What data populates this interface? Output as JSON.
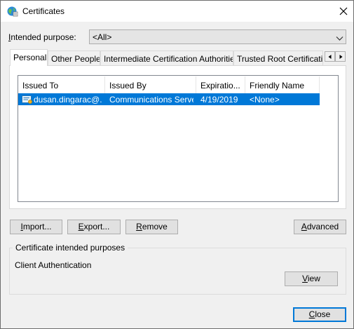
{
  "window": {
    "title": "Certificates",
    "icon": "certificate-globe-icon"
  },
  "purpose": {
    "label": "Intended purpose:",
    "label_accel": "I",
    "label_rest": "ntended purpose:",
    "value": "<All>"
  },
  "tabs": [
    {
      "label": "Personal",
      "active": true
    },
    {
      "label": "Other People",
      "active": false
    },
    {
      "label": "Intermediate Certification Authorities",
      "active": false
    },
    {
      "label": "Trusted Root Certification",
      "active": false
    }
  ],
  "table": {
    "columns": [
      "Issued To",
      "Issued By",
      "Expiratio...",
      "Friendly Name"
    ],
    "rows": [
      {
        "issued_to": "dusan.dingarac@...",
        "issued_by": "Communications Server",
        "expiration": "4/19/2019",
        "friendly_name": "<None>",
        "selected": true
      }
    ]
  },
  "buttons": {
    "import": {
      "accel": "I",
      "rest": "mport..."
    },
    "export": {
      "accel": "E",
      "rest": "xport..."
    },
    "remove": {
      "accel": "R",
      "rest": "emove"
    },
    "advanced": {
      "accel": "A",
      "rest": "dvanced"
    },
    "view": {
      "accel": "V",
      "rest": "iew"
    },
    "close": {
      "accel": "C",
      "rest": "lose"
    }
  },
  "purposes_group": {
    "legend": "Certificate intended purposes",
    "value": "Client Authentication"
  },
  "colors": {
    "selection": "#0078d7",
    "default_button_border": "#0078d7",
    "dialog_bg": "#f0f0f0"
  }
}
